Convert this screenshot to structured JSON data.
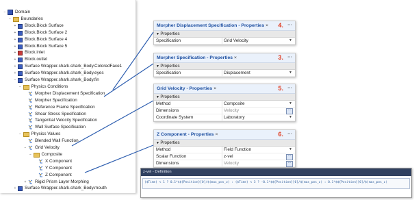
{
  "tree": {
    "items": [
      {
        "label": "Domain",
        "icon": "domain-icon",
        "toggle": "−"
      },
      {
        "label": "Boundaries",
        "icon": "folder-icon",
        "toggle": "−"
      },
      {
        "label": "Block.Block Surface",
        "icon": "boundary-icon",
        "toggle": "+"
      },
      {
        "label": "Block.Block Surface 2",
        "icon": "boundary-icon",
        "toggle": "+"
      },
      {
        "label": "Block.Block Surface 4",
        "icon": "boundary-icon",
        "toggle": "+"
      },
      {
        "label": "Block.Block Surface 5",
        "icon": "boundary-icon",
        "toggle": "+"
      },
      {
        "label": "Block.inlet",
        "icon": "inlet-icon",
        "toggle": "+"
      },
      {
        "label": "Block.outlet",
        "icon": "boundary-icon",
        "toggle": "+"
      },
      {
        "label": "Surface Wrapper.shark.shark_Body.ColoredFace1",
        "icon": "boundary-icon",
        "toggle": "+"
      },
      {
        "label": "Surface Wrapper.shark.shark_Body.eyes",
        "icon": "boundary-icon",
        "toggle": "+"
      },
      {
        "label": "Surface Wrapper.shark.shark_Body.fin",
        "icon": "boundary-icon",
        "toggle": "−"
      },
      {
        "label": "Physics Conditions",
        "icon": "folder-icon",
        "toggle": "−"
      },
      {
        "label": "Morpher Displacement Specification",
        "icon": "physics-icon",
        "toggle": ""
      },
      {
        "label": "Morpher Specification",
        "icon": "physics-icon",
        "toggle": ""
      },
      {
        "label": "Reference Frame Specification",
        "icon": "physics-icon",
        "toggle": ""
      },
      {
        "label": "Shear Stress Specification",
        "icon": "physics-icon",
        "toggle": ""
      },
      {
        "label": "Tangential Velocity Specification",
        "icon": "physics-icon",
        "toggle": ""
      },
      {
        "label": "Wall Surface Specification",
        "icon": "physics-icon",
        "toggle": ""
      },
      {
        "label": "Physics Values",
        "icon": "folder-icon",
        "toggle": "−"
      },
      {
        "label": "Blended Wall Function",
        "icon": "physics-icon",
        "toggle": ""
      },
      {
        "label": "Grid Velocity",
        "icon": "physics-icon",
        "toggle": "−"
      },
      {
        "label": "Composite",
        "icon": "folder-icon",
        "toggle": "−"
      },
      {
        "label": "X Component",
        "icon": "physics-icon",
        "toggle": ""
      },
      {
        "label": "Y Component",
        "icon": "physics-icon",
        "toggle": ""
      },
      {
        "label": "Z Component",
        "icon": "physics-icon",
        "toggle": ""
      },
      {
        "label": "Rigid Prism Layer Morphing",
        "icon": "physics-icon",
        "toggle": "+"
      },
      {
        "label": "Surface Wrapper.shark.shark_Body.mouth",
        "icon": "boundary-icon",
        "toggle": "+"
      }
    ]
  },
  "panels": [
    {
      "title": "Morpher Displacement Specification - Properties",
      "close": "×",
      "number": "4.",
      "more": "···",
      "section": "Properties",
      "rows": [
        {
          "key": "Specification",
          "value": "Grid Velocity",
          "control": "dropdown"
        }
      ]
    },
    {
      "title": "Morpher Specification - Properties",
      "close": "×",
      "number": "3.",
      "more": "···",
      "section": "Properties",
      "rows": [
        {
          "key": "Specification",
          "value": "Displacement",
          "control": "dropdown"
        }
      ]
    },
    {
      "title": "Grid Velocity - Properties",
      "close": "×",
      "number": "5.",
      "more": "···",
      "section": "Properties",
      "rows": [
        {
          "key": "Method",
          "value": "Composite",
          "control": "dropdown"
        },
        {
          "key": "Dimensions",
          "value": "Velocity",
          "control": "edit",
          "muted": true
        },
        {
          "key": "Coordinate System",
          "value": "Laboratory",
          "control": "dropdown"
        }
      ]
    },
    {
      "title": "Z Component - Properties",
      "close": "×",
      "number": "6.",
      "more": "···",
      "section": "Properties",
      "rows": [
        {
          "key": "Method",
          "value": "Field Function",
          "control": "dropdown"
        },
        {
          "key": "Scalar Function",
          "value": "z-vel",
          "control": "edit"
        },
        {
          "key": "Dimensions",
          "value": "Velocity",
          "control": "edit",
          "muted": true
        }
      ]
    }
  ],
  "definition": {
    "title": "z-vel - Definition",
    "expression": "($Time) < 1 ? 0.1*$${Position}[0]/$(max_pos_z) : ($Time) < 3 ? -0.1*$${Position}[0]/$(max_pos_z) : 0.1*$${Position}[0]/$(max_pos_z)"
  },
  "colors": {
    "panel_title": "#1c4ea0",
    "panel_title_bg": "#eaf1fb",
    "step_number": "#e03a1e",
    "connector_line": "#2f5fb0",
    "definition_title_bg": "#314160"
  }
}
